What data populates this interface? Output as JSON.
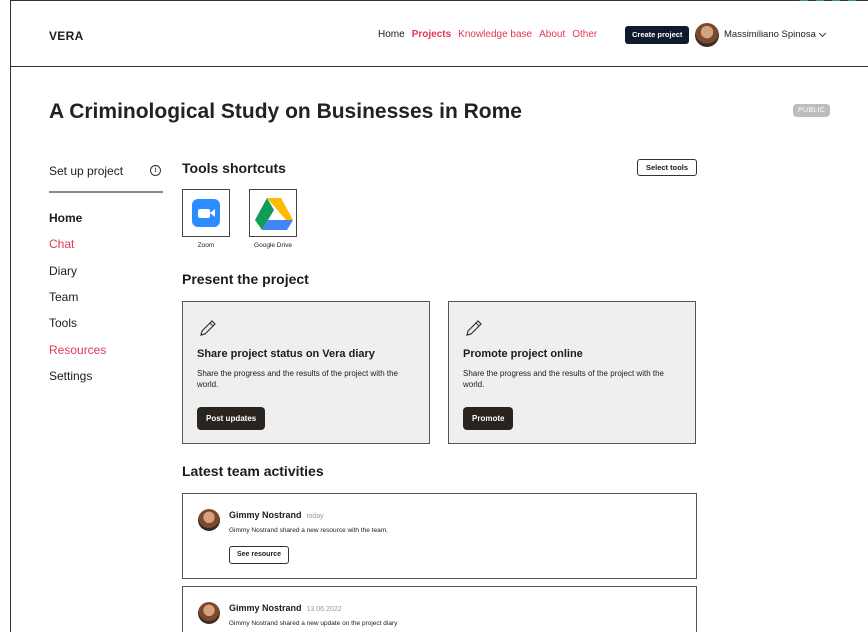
{
  "header": {
    "logo": "VERA",
    "nav": [
      {
        "label": "Home",
        "style": "plain"
      },
      {
        "label": "Projects",
        "style": "active"
      },
      {
        "label": "Knowledge base",
        "style": "link"
      },
      {
        "label": "About",
        "style": "link"
      },
      {
        "label": "Other",
        "style": "link"
      }
    ],
    "create_label": "Create project",
    "user_name": "Massimiliano Spinosa"
  },
  "project": {
    "title": "A Criminological Study on Businesses in Rome",
    "visibility": "PUBLIC"
  },
  "sidebar": {
    "setup_label": "Set up project",
    "items": [
      {
        "label": "Home",
        "style": "bold"
      },
      {
        "label": "Chat",
        "style": "red"
      },
      {
        "label": "Diary",
        "style": "plain"
      },
      {
        "label": "Team",
        "style": "plain"
      },
      {
        "label": "Tools",
        "style": "plain"
      },
      {
        "label": "Resources",
        "style": "red"
      },
      {
        "label": "Settings",
        "style": "plain"
      }
    ]
  },
  "tools": {
    "heading": "Tools shortcuts",
    "select_label": "Select tools",
    "items": [
      {
        "label": "Zoom",
        "icon": "zoom-icon"
      },
      {
        "label": "Google Drive",
        "icon": "google-drive-icon"
      }
    ]
  },
  "present": {
    "heading": "Present the project",
    "cards": [
      {
        "title": "Share project status on Vera diary",
        "desc": "Share the progress and the results of the project with the world.",
        "button": "Post updates"
      },
      {
        "title": "Promote project online",
        "desc": "Share the progress and the results of the project with the world.",
        "button": "Promote"
      }
    ]
  },
  "activities": {
    "heading": "Latest team activities",
    "items": [
      {
        "name": "Gimmy Nostrand",
        "when": "today",
        "message": "Gimmy Nostrand shared a new resource with the team.",
        "button": "See resource"
      },
      {
        "name": "Gimmy Nostrand",
        "when": "13.06.2022",
        "message": "Gimmy Nostrand shared a new update on the project diary"
      }
    ]
  },
  "colors": {
    "accent": "#e2365b",
    "dark_button": "#101a2b",
    "card_bg": "#efefef",
    "zoom": "#2d8cff"
  }
}
